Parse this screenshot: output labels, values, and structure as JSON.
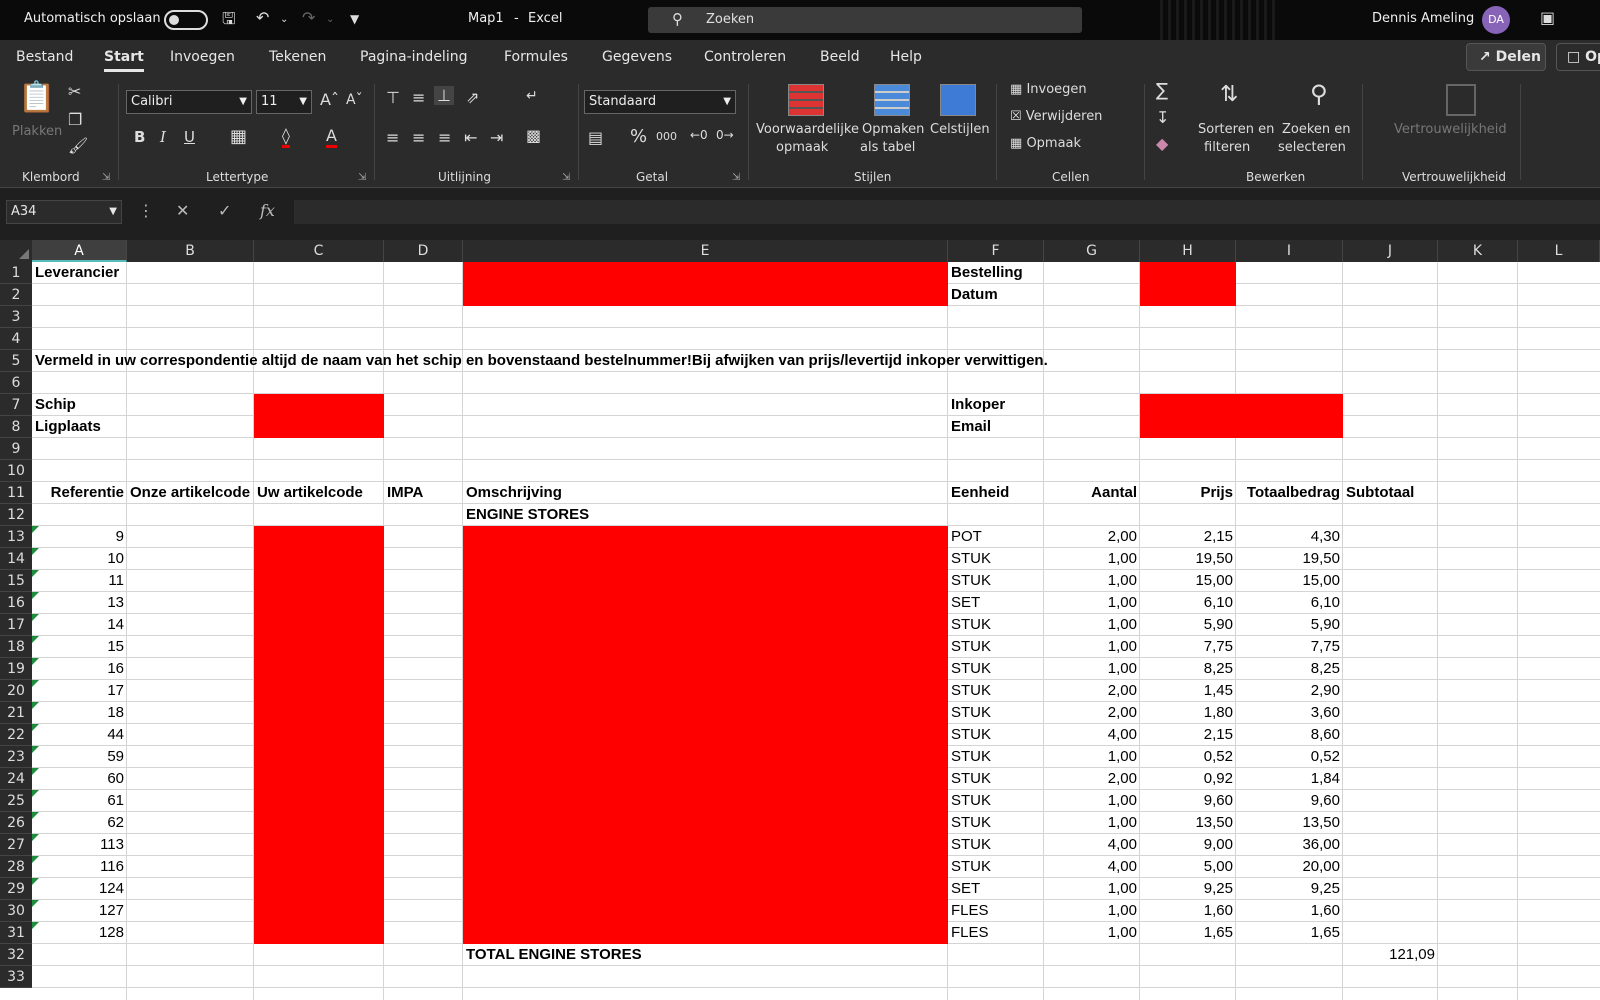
{
  "titlebar": {
    "autosave_label": "Automatisch opslaan",
    "doc_name": "Map1",
    "separator": "-",
    "app_name": "Excel",
    "search_placeholder": "Zoeken",
    "user_name": "Dennis Ameling",
    "user_initials": "DA"
  },
  "menu": {
    "tabs": [
      "Bestand",
      "Start",
      "Invoegen",
      "Tekenen",
      "Pagina-indeling",
      "Formules",
      "Gegevens",
      "Controleren",
      "Beeld",
      "Help"
    ],
    "active": "Start",
    "share_label": "Delen",
    "comments_label": "Op"
  },
  "ribbon": {
    "clipboard": {
      "paste_label": "Plakken",
      "group": "Klembord"
    },
    "font": {
      "name": "Calibri",
      "size": "11",
      "group": "Lettertype",
      "bold": "B",
      "italic": "I",
      "underline": "U"
    },
    "alignment": {
      "group": "Uitlijning"
    },
    "number": {
      "format": "Standaard",
      "group": "Getal",
      "percent": "%",
      "thousands": "000"
    },
    "styles": {
      "conditional_l1": "Voorwaardelijke",
      "conditional_l2": "opmaak",
      "table_l1": "Opmaken",
      "table_l2": "als tabel",
      "cellstyles": "Celstijlen",
      "group": "Stijlen"
    },
    "cells": {
      "insert": "Invoegen",
      "delete": "Verwijderen",
      "format": "Opmaak",
      "group": "Cellen"
    },
    "editing": {
      "sort_l1": "Sorteren en",
      "sort_l2": "filteren",
      "find_l1": "Zoeken en",
      "find_l2": "selecteren",
      "group": "Bewerken"
    },
    "sensitivity": {
      "label": "Vertrouwelijkheid",
      "group": "Vertrouwelijkheid"
    }
  },
  "formula_bar": {
    "name_box": "A34",
    "fx": "fx",
    "value": ""
  },
  "sheet": {
    "columns": [
      "A",
      "B",
      "C",
      "D",
      "E",
      "F",
      "G",
      "H",
      "I",
      "J",
      "K",
      "L"
    ],
    "rows": [
      "1",
      "2",
      "3",
      "4",
      "5",
      "6",
      "7",
      "8",
      "9",
      "10",
      "11",
      "12",
      "13",
      "14",
      "15",
      "16",
      "17",
      "18",
      "19",
      "20",
      "21",
      "22",
      "23",
      "24",
      "25",
      "26",
      "27",
      "28",
      "29",
      "30",
      "31",
      "32",
      "33"
    ],
    "selected_column": "A",
    "labels": {
      "leverancier": "Leverancier",
      "bestelling": "Bestelling",
      "datum": "Datum",
      "note": "Vermeld in uw correspondentie altijd de naam van het schip en bovenstaand bestelnummer!Bij afwijken van prijs/levertijd inkoper verwittigen.",
      "schip": "Schip",
      "ligplaats": "Ligplaats",
      "inkoper": "Inkoper",
      "email": "Email"
    },
    "headers": {
      "referentie": "Referentie",
      "onze": "Onze artikelcode",
      "uw": "Uw artikelcode",
      "impa": "IMPA",
      "omschrijving": "Omschrijving",
      "eenheid": "Eenheid",
      "aantal": "Aantal",
      "prijs": "Prijs",
      "totaal": "Totaalbedrag",
      "subtotaal": "Subtotaal"
    },
    "section_title": "ENGINE STORES",
    "items": [
      {
        "ref": "9",
        "unit": "POT",
        "qty": "2,00",
        "price": "2,15",
        "total": "4,30"
      },
      {
        "ref": "10",
        "unit": "STUK",
        "qty": "1,00",
        "price": "19,50",
        "total": "19,50"
      },
      {
        "ref": "11",
        "unit": "STUK",
        "qty": "1,00",
        "price": "15,00",
        "total": "15,00"
      },
      {
        "ref": "13",
        "unit": "SET",
        "qty": "1,00",
        "price": "6,10",
        "total": "6,10"
      },
      {
        "ref": "14",
        "unit": "STUK",
        "qty": "1,00",
        "price": "5,90",
        "total": "5,90"
      },
      {
        "ref": "15",
        "unit": "STUK",
        "qty": "1,00",
        "price": "7,75",
        "total": "7,75"
      },
      {
        "ref": "16",
        "unit": "STUK",
        "qty": "1,00",
        "price": "8,25",
        "total": "8,25"
      },
      {
        "ref": "17",
        "unit": "STUK",
        "qty": "2,00",
        "price": "1,45",
        "total": "2,90"
      },
      {
        "ref": "18",
        "unit": "STUK",
        "qty": "2,00",
        "price": "1,80",
        "total": "3,60"
      },
      {
        "ref": "44",
        "unit": "STUK",
        "qty": "4,00",
        "price": "2,15",
        "total": "8,60"
      },
      {
        "ref": "59",
        "unit": "STUK",
        "qty": "1,00",
        "price": "0,52",
        "total": "0,52"
      },
      {
        "ref": "60",
        "unit": "STUK",
        "qty": "2,00",
        "price": "0,92",
        "total": "1,84"
      },
      {
        "ref": "61",
        "unit": "STUK",
        "qty": "1,00",
        "price": "9,60",
        "total": "9,60"
      },
      {
        "ref": "62",
        "unit": "STUK",
        "qty": "1,00",
        "price": "13,50",
        "total": "13,50"
      },
      {
        "ref": "113",
        "unit": "STUK",
        "qty": "4,00",
        "price": "9,00",
        "total": "36,00"
      },
      {
        "ref": "116",
        "unit": "STUK",
        "qty": "4,00",
        "price": "5,00",
        "total": "20,00"
      },
      {
        "ref": "124",
        "unit": "SET",
        "qty": "1,00",
        "price": "9,25",
        "total": "9,25"
      },
      {
        "ref": "127",
        "unit": "FLES",
        "qty": "1,00",
        "price": "1,60",
        "total": "1,60"
      },
      {
        "ref": "128",
        "unit": "FLES",
        "qty": "1,00",
        "price": "1,65",
        "total": "1,65"
      }
    ],
    "total_label": "TOTAL ENGINE STORES",
    "subtotal_value": "121,09",
    "redaction_color": "#ff0000"
  }
}
